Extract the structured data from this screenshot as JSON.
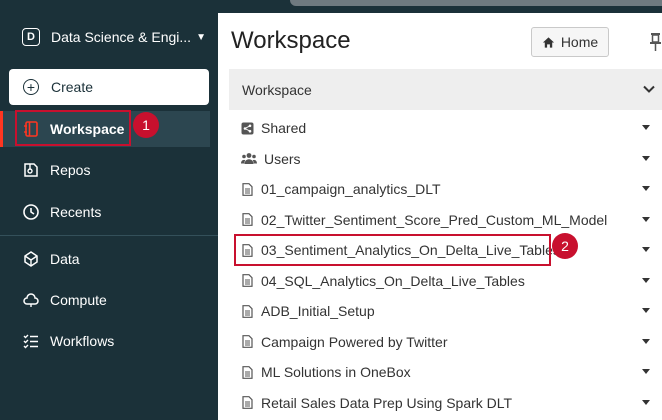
{
  "workspace_switcher": {
    "logo_letter": "D",
    "name": "Data Science & Engi..."
  },
  "sidebar": {
    "create_label": "Create",
    "items": [
      {
        "label": "Workspace",
        "icon": "workspace-icon",
        "active": true
      },
      {
        "label": "Repos",
        "icon": "repos-icon"
      },
      {
        "label": "Recents",
        "icon": "clock-icon"
      },
      {
        "label": "Data",
        "icon": "data-icon"
      },
      {
        "label": "Compute",
        "icon": "compute-icon"
      },
      {
        "label": "Workflows",
        "icon": "workflows-icon"
      }
    ]
  },
  "main": {
    "title": "Workspace",
    "home_button": "Home",
    "browser_header": "Workspace",
    "entries": [
      {
        "label": "Shared",
        "icon": "share-icon"
      },
      {
        "label": "Users",
        "icon": "users-icon"
      },
      {
        "label": "01_campaign_analytics_DLT",
        "icon": "notebook-icon"
      },
      {
        "label": "02_Twitter_Sentiment_Score_Pred_Custom_ML_Model",
        "icon": "notebook-icon"
      },
      {
        "label": "03_Sentiment_Analytics_On_Delta_Live_Tables",
        "icon": "notebook-icon"
      },
      {
        "label": "04_SQL_Analytics_On_Delta_Live_Tables",
        "icon": "notebook-icon"
      },
      {
        "label": "ADB_Initial_Setup",
        "icon": "notebook-icon"
      },
      {
        "label": "Campaign Powered by Twitter",
        "icon": "notebook-icon"
      },
      {
        "label": "ML Solutions in OneBox",
        "icon": "notebook-icon"
      },
      {
        "label": "Retail Sales Data Prep Using Spark DLT",
        "icon": "notebook-icon"
      }
    ]
  },
  "annotations": {
    "marker_1": "1",
    "marker_2": "2"
  },
  "colors": {
    "sidebar_bg": "#1b3139",
    "active_accent": "#ff3621",
    "callout": "#c8102e"
  }
}
